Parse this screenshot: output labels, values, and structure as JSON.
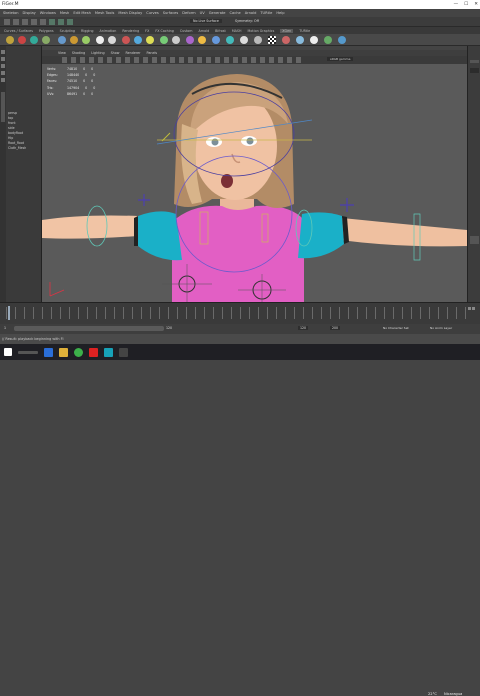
{
  "titlebar": {
    "title": "FiGer.M",
    "controls": [
      "—",
      "☐",
      "✕"
    ]
  },
  "menu": [
    "Skeleton",
    "Display",
    "Windows",
    "Mesh",
    "Edit Mesh",
    "Mesh Tools",
    "Mesh Display",
    "Curves",
    "Surfaces",
    "Deform",
    "UV",
    "Generate",
    "Cache",
    "Arnold",
    "TURtle",
    "Help"
  ],
  "toolbar": {
    "mode": "No Live Surface",
    "symmetry": "Symmetry: Off"
  },
  "shelf_tabs": [
    "Curves / Surfaces",
    "Polygons",
    "Sculpting",
    "Rigging",
    "Animation",
    "Rendering",
    "FX",
    "FX Caching",
    "Custom",
    "Arnold",
    "Bifrost",
    "MASH",
    "Motion Graphics",
    "XGen",
    "TURtle"
  ],
  "viewport_menu": [
    "View",
    "Shading",
    "Lighting",
    "Show",
    "Renderer",
    "Panels"
  ],
  "hud": [
    {
      "label": "Verts:",
      "a": "74810",
      "b": "0",
      "c": "0"
    },
    {
      "label": "Edges:",
      "a": "148440",
      "b": "0",
      "c": "0"
    },
    {
      "label": "Faces:",
      "a": "74510",
      "b": "0",
      "c": "0"
    },
    {
      "label": "Tris:",
      "a": "147904",
      "b": "0",
      "c": "0"
    },
    {
      "label": "UVs:",
      "a": "86491",
      "b": "0",
      "c": "0"
    }
  ],
  "colorspace": "sRGB gamma",
  "outliner": [
    "persp",
    "top",
    "front",
    "side",
    "bodyRoot",
    "Hip",
    "Root_Root",
    "Cloth_Mesh"
  ],
  "timeline": {
    "start": "1",
    "end": "120",
    "range_end": "120",
    "range_max": "200",
    "current": "1"
  },
  "range": {
    "character_set": "No Character Set",
    "anim_layer": "No Anim Layer"
  },
  "cmdline": "// Result: playback beginning with FI",
  "weather": {
    "temp": "22°C",
    "place": "Nicaragua"
  },
  "colors": {
    "shirt_pink": "#e25fc4",
    "sleeve_cyan": "#1ab0c8",
    "skin": "#f0c2a3",
    "hair": "#caa27c"
  }
}
